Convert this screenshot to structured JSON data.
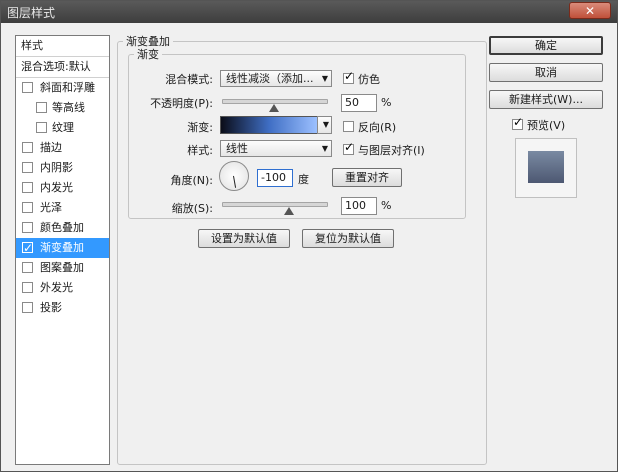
{
  "window": {
    "title": "图层样式",
    "close_glyph": "✕"
  },
  "stylelist": {
    "header_styles": "样式",
    "header_blend": "混合选项:默认",
    "items": [
      {
        "label": "斜面和浮雕",
        "checked": false,
        "sub": false,
        "selected": false
      },
      {
        "label": "等高线",
        "checked": false,
        "sub": true,
        "selected": false
      },
      {
        "label": "纹理",
        "checked": false,
        "sub": true,
        "selected": false
      },
      {
        "label": "描边",
        "checked": false,
        "sub": false,
        "selected": false
      },
      {
        "label": "内阴影",
        "checked": false,
        "sub": false,
        "selected": false
      },
      {
        "label": "内发光",
        "checked": false,
        "sub": false,
        "selected": false
      },
      {
        "label": "光泽",
        "checked": false,
        "sub": false,
        "selected": false
      },
      {
        "label": "颜色叠加",
        "checked": false,
        "sub": false,
        "selected": false
      },
      {
        "label": "渐变叠加",
        "checked": true,
        "sub": false,
        "selected": true
      },
      {
        "label": "图案叠加",
        "checked": false,
        "sub": false,
        "selected": false
      },
      {
        "label": "外发光",
        "checked": false,
        "sub": false,
        "selected": false
      },
      {
        "label": "投影",
        "checked": false,
        "sub": false,
        "selected": false
      }
    ]
  },
  "panel": {
    "section_title": "渐变叠加",
    "group_title": "渐变",
    "blend_mode_label": "混合模式:",
    "blend_mode_value": "线性减淡（添加...",
    "dither_label": "仿色",
    "dither_checked": true,
    "opacity_label": "不透明度(P):",
    "opacity_value": "50",
    "opacity_level": 50,
    "percent": "%",
    "gradient_label": "渐变:",
    "reverse_label": "反向(R)",
    "reverse_checked": false,
    "style_label": "样式:",
    "style_value": "线性",
    "align_label": "与图层对齐(I)",
    "align_checked": true,
    "angle_label": "角度(N):",
    "angle_value": "-100",
    "angle_unit": "度",
    "reset_align_button": "重置对齐",
    "scale_label": "缩放(S):",
    "scale_value": "100",
    "scale_level": 100,
    "set_default_button": "设置为默认值",
    "reset_default_button": "复位为默认值"
  },
  "right": {
    "ok_button": "确定",
    "cancel_button": "取消",
    "new_style_button": "新建样式(W)...",
    "preview_label": "预览(V)",
    "preview_checked": true
  }
}
